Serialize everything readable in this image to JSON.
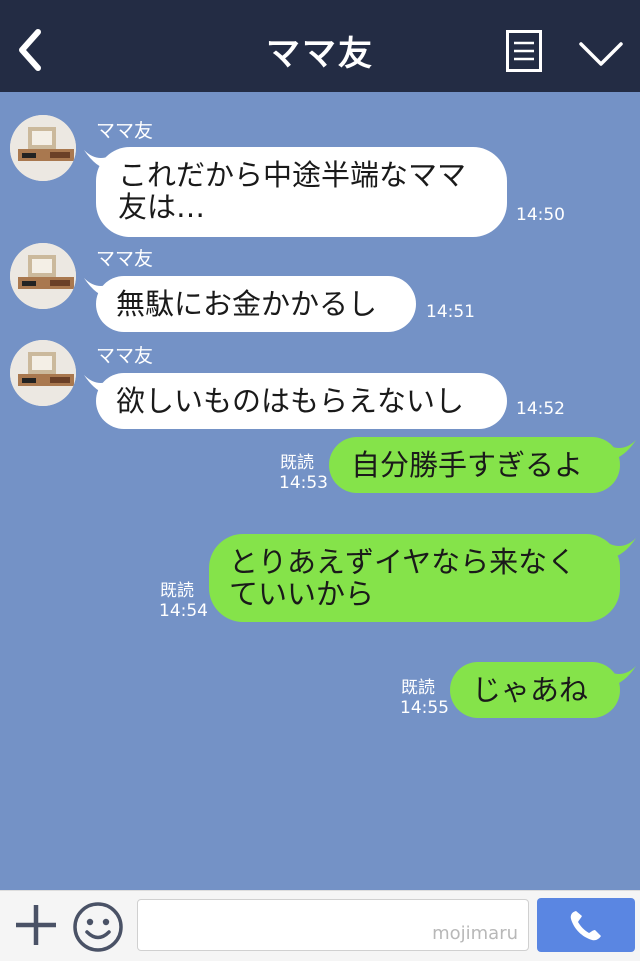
{
  "header": {
    "title": "ママ友"
  },
  "messages": [
    {
      "direction": "in",
      "sender": "ママ友",
      "text": "これだから中途半端なママ友は…",
      "time": "14:50"
    },
    {
      "direction": "in",
      "sender": "ママ友",
      "text": "無駄にお金かかるし",
      "time": "14:51"
    },
    {
      "direction": "in",
      "sender": "ママ友",
      "text": "欲しいものはもらえないし",
      "time": "14:52"
    },
    {
      "direction": "out",
      "read": "既読",
      "text": "自分勝手すぎるよ",
      "time": "14:53"
    },
    {
      "direction": "out",
      "read": "既読",
      "text": "とりあえずイヤなら来なくていいから",
      "time": "14:54"
    },
    {
      "direction": "out",
      "read": "既読",
      "text": "じゃあね",
      "time": "14:55"
    }
  ],
  "input": {
    "watermark": "mojimaru"
  },
  "colors": {
    "header_bg": "#232c44",
    "chat_bg": "#7492c6",
    "incoming_bubble": "#ffffff",
    "outgoing_bubble": "#85e34a",
    "call_button": "#5a86e2"
  },
  "icons": [
    "back-arrow-icon",
    "menu-list-icon",
    "chevron-down-icon",
    "plus-icon",
    "smiley-icon",
    "phone-icon"
  ]
}
